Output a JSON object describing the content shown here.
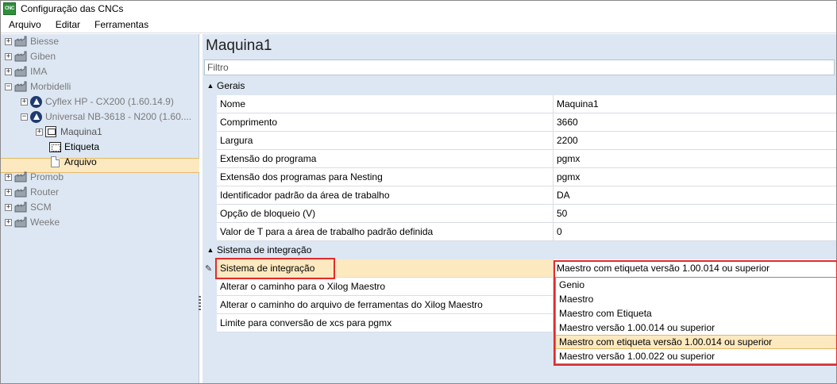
{
  "window": {
    "title": "Configuração das CNCs",
    "icon_text": "CNC"
  },
  "menu": [
    "Arquivo",
    "Editar",
    "Ferramentas"
  ],
  "tree": {
    "manufacturers": [
      {
        "label": "Biesse",
        "expander": "+"
      },
      {
        "label": "Giben",
        "expander": "+"
      },
      {
        "label": "IMA",
        "expander": "+"
      },
      {
        "label": "Morbidelli",
        "expander": "−"
      },
      {
        "label": "Promob",
        "expander": "+"
      },
      {
        "label": "Router",
        "expander": "+"
      },
      {
        "label": "SCM",
        "expander": "+"
      },
      {
        "label": "Weeke",
        "expander": "+"
      }
    ],
    "machines": [
      {
        "label": "Cyflex HP - CX200 (1.60.14.9)",
        "expander": "+"
      },
      {
        "label": "Universal NB-3618 - N200 (1.60....",
        "expander": "−"
      }
    ],
    "selected": {
      "label": "Maquina1",
      "expander": "+"
    },
    "children": [
      "Etiqueta",
      "Arquivo"
    ]
  },
  "panel": {
    "title": "Maquina1",
    "filter_placeholder": "Filtro",
    "groups": [
      {
        "name": "Gerais",
        "rows": [
          {
            "name": "Nome",
            "value": "Maquina1"
          },
          {
            "name": "Comprimento",
            "value": "3660"
          },
          {
            "name": "Largura",
            "value": "2200"
          },
          {
            "name": "Extensão do programa",
            "value": "pgmx"
          },
          {
            "name": "Extensão dos programas para Nesting",
            "value": "pgmx"
          },
          {
            "name": "Identificador padrão da área de trabalho",
            "value": "DA"
          },
          {
            "name": "Opção de bloqueio (V)",
            "value": "50"
          },
          {
            "name": "Valor de T para a área de trabalho padrão definida",
            "value": "0"
          }
        ]
      },
      {
        "name": "Sistema de integração",
        "rows": [
          {
            "name": "Sistema de integração",
            "value": "Maestro com etiqueta versão 1.00.014 ou superior"
          },
          {
            "name": "Alterar o caminho para o Xilog Maestro",
            "value": ""
          },
          {
            "name": "Alterar o caminho do arquivo de ferramentas do Xilog Maestro",
            "value": ""
          },
          {
            "name": "Limite para conversão de xcs para pgmx",
            "value": ""
          }
        ]
      }
    ],
    "dropdown_options": [
      "Genio",
      "Maestro",
      "Maestro com Etiqueta",
      "Maestro versão 1.00.014 ou superior",
      "Maestro com etiqueta versão 1.00.014 ou superior",
      "Maestro versão 1.00.022 ou superior"
    ],
    "dropdown_selected": "Maestro com etiqueta versão 1.00.014 ou superior"
  },
  "colors": {
    "tree_bg": "#dde7f3",
    "selection": "#fde9bf",
    "highlight_box": "#e22b2b"
  }
}
